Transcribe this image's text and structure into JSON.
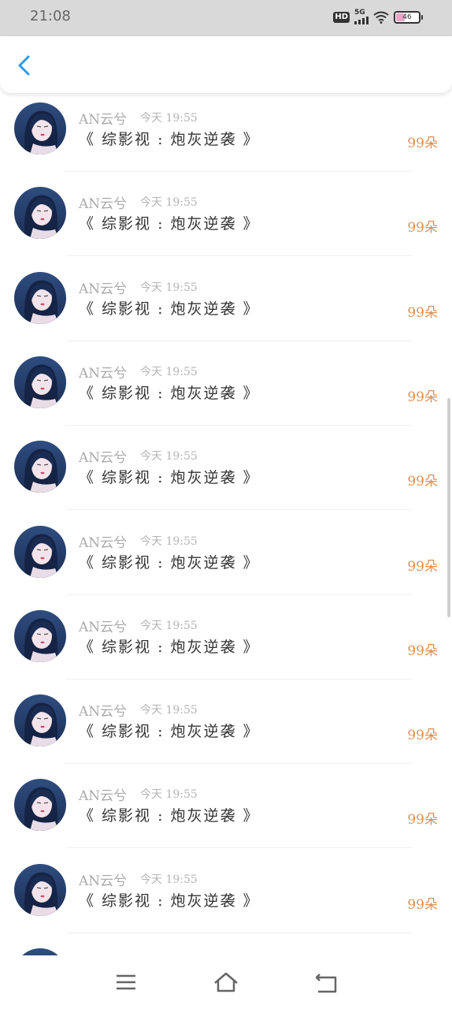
{
  "status_bar": {
    "time": "21:08",
    "hd_label": "HD",
    "network": "5G",
    "battery": "46"
  },
  "nav": {
    "back_icon": "chevron-left-icon",
    "accent_color": "#2c9be6"
  },
  "list": {
    "items": [
      {
        "name": "AN云兮",
        "time": "今天 19:55",
        "title": "《 综影视 : 炮灰逆袭 》",
        "amount": "99朵"
      },
      {
        "name": "AN云兮",
        "time": "今天 19:55",
        "title": "《 综影视 : 炮灰逆袭 》",
        "amount": "99朵"
      },
      {
        "name": "AN云兮",
        "time": "今天 19:55",
        "title": "《 综影视 : 炮灰逆袭 》",
        "amount": "99朵"
      },
      {
        "name": "AN云兮",
        "time": "今天 19:55",
        "title": "《 综影视 : 炮灰逆袭 》",
        "amount": "99朵"
      },
      {
        "name": "AN云兮",
        "time": "今天 19:55",
        "title": "《 综影视 : 炮灰逆袭 》",
        "amount": "99朵"
      },
      {
        "name": "AN云兮",
        "time": "今天 19:55",
        "title": "《 综影视 : 炮灰逆袭 》",
        "amount": "99朵"
      },
      {
        "name": "AN云兮",
        "time": "今天 19:55",
        "title": "《 综影视 : 炮灰逆袭 》",
        "amount": "99朵"
      },
      {
        "name": "AN云兮",
        "time": "今天 19:55",
        "title": "《 综影视 : 炮灰逆袭 》",
        "amount": "99朵"
      },
      {
        "name": "AN云兮",
        "time": "今天 19:55",
        "title": "《 综影视 : 炮灰逆袭 》",
        "amount": "99朵"
      },
      {
        "name": "AN云兮",
        "time": "今天 19:55",
        "title": "《 综影视 : 炮灰逆袭 》",
        "amount": "99朵"
      }
    ],
    "amount_color": "#e0904f"
  },
  "bottom_nav": {
    "menu_icon": "menu-icon",
    "home_icon": "home-icon",
    "back_icon": "return-icon"
  }
}
